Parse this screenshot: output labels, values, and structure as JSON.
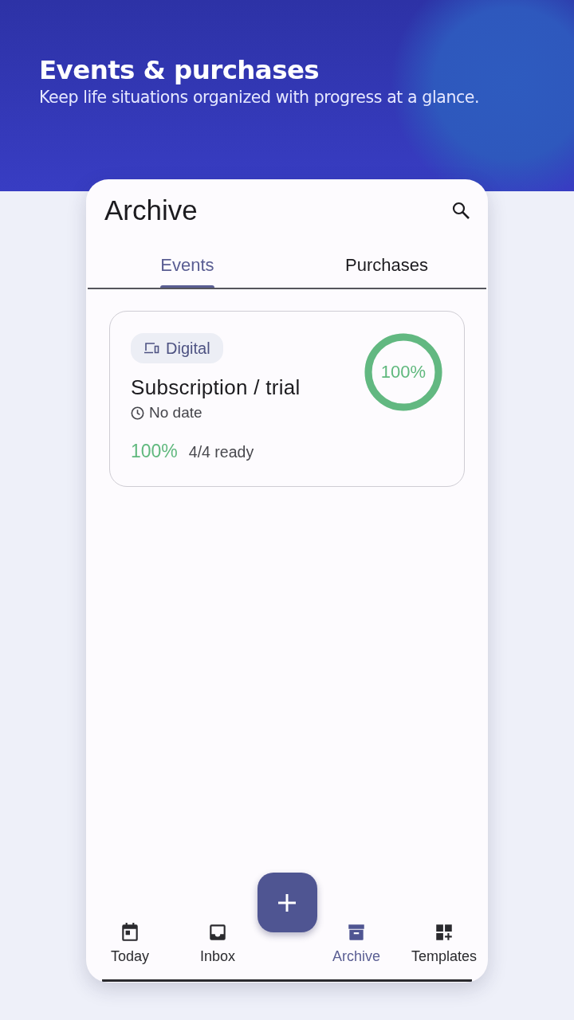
{
  "header": {
    "title": "Events & purchases",
    "subtitle": "Keep life situations organized with progress at a glance."
  },
  "app": {
    "title": "Archive",
    "tabs": [
      {
        "label": "Events",
        "selected": true
      },
      {
        "label": "Purchases",
        "selected": false
      }
    ],
    "cards": [
      {
        "tag": "Digital",
        "title": "Subscription / trial",
        "date": "No date",
        "percent": "100%",
        "ready": "4/4 ready",
        "ring_label": "100%",
        "level": 1
      }
    ],
    "nav": [
      {
        "kind": "calendar",
        "label": "Today",
        "selected": false
      },
      {
        "kind": "inbox",
        "label": "Inbox",
        "selected": false
      },
      {
        "kind": "fab"
      },
      {
        "kind": "archive",
        "label": "Archive",
        "selected": true
      },
      {
        "kind": "templates",
        "label": "Templates",
        "selected": false
      }
    ]
  }
}
